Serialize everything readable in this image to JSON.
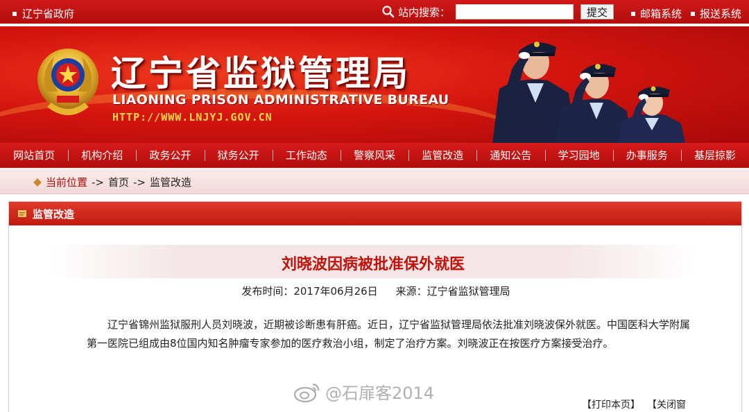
{
  "topbar": {
    "home_link": "辽宁省政府",
    "search_label": "站内搜索：",
    "search_value": "",
    "submit_label": "提交",
    "mail_link": "邮箱系统",
    "report_link": "报送系统"
  },
  "banner": {
    "title_cn": "辽宁省监狱管理局",
    "title_en": "LIAONING PRISON ADMINISTRATIVE BUREAU",
    "url": "HTTP://WWW.LNJYJ.GOV.CN"
  },
  "nav": {
    "items": [
      {
        "label": "网站首页"
      },
      {
        "label": "机构介绍"
      },
      {
        "label": "政务公开"
      },
      {
        "label": "狱务公开"
      },
      {
        "label": "工作动态"
      },
      {
        "label": "警察风采"
      },
      {
        "label": "监管改造"
      },
      {
        "label": "通知公告"
      },
      {
        "label": "学习园地"
      },
      {
        "label": "办事服务"
      },
      {
        "label": "基层掠影"
      }
    ]
  },
  "breadcrumb": {
    "current_label": "当前位置",
    "separator1": "->",
    "home": "首页",
    "separator2": "->",
    "section": "监管改造"
  },
  "panel": {
    "title": "监管改造"
  },
  "article": {
    "title": "刘晓波因病被批准保外就医",
    "publish_label": "发布时间：2017年06月26日",
    "source_label": "来源：辽宁省监狱管理局",
    "body": "辽宁省锦州监狱服刑人员刘晓波，近期被诊断患有肝癌。近日，辽宁省监狱管理局依法批准刘晓波保外就医。中国医科大学附属第一医院已组成由8位国内知名肿瘤专家参加的医疗救治小组，制定了治疗方案。刘晓波正在按医疗方案接受治疗。"
  },
  "watermark": {
    "text": "@石扉客2014"
  },
  "actions": {
    "print": "【打印本页】",
    "close": "【关闭窗"
  },
  "colors": {
    "brand_red": "#c0120a",
    "nav_red": "#b00c0c",
    "url_yellow": "#ffd94a"
  }
}
